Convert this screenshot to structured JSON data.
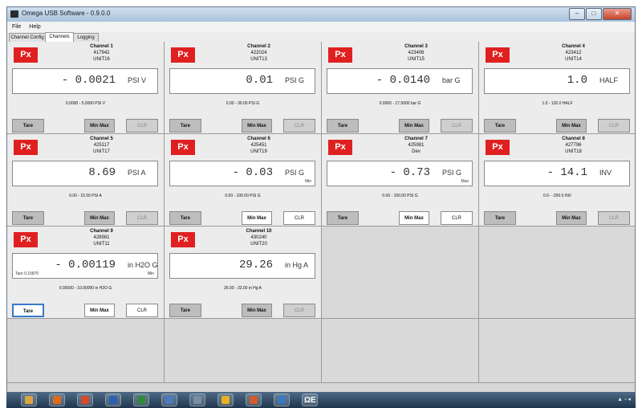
{
  "window": {
    "title": "Omega USB Software - 0.9.0.0",
    "controls": [
      "–",
      "□",
      "✕"
    ]
  },
  "menu": [
    "File",
    "Help"
  ],
  "tabs": [
    "Channel Config",
    "Channels",
    "Logging"
  ],
  "active_tab": "Channels",
  "logo_text": "Px",
  "channels": [
    {
      "title": "Channel 1",
      "serial": "417942",
      "unit_id": "UNIT16",
      "value": "- 0.0021",
      "unit": "PSI V",
      "range": "0.0000 - 5.0000 PSI V",
      "flag": "",
      "tare_note": "",
      "tare": "Tare",
      "minmax": "Min Max",
      "clr": "CLR"
    },
    {
      "title": "Channel 2",
      "serial": "422024",
      "unit_id": "UNIT13",
      "value": "0.01",
      "unit": "PSI G",
      "range": "0.00 - 30.00 PSI G",
      "flag": "",
      "tare_note": "",
      "tare": "Tare",
      "minmax": "Min Max",
      "clr": "CLR"
    },
    {
      "title": "Channel 3",
      "serial": "423406",
      "unit_id": "UNIT15",
      "value": "- 0.0140",
      "unit": "bar G",
      "range": "0.0000 - 17.5000 bar G",
      "flag": "",
      "tare_note": "",
      "tare": "Tare",
      "minmax": "Min Max",
      "clr": "CLR"
    },
    {
      "title": "Channel 4",
      "serial": "423412",
      "unit_id": "UNIT14",
      "value": "1.0",
      "unit": "HALF",
      "range": "1.0 - 126.0 HALF",
      "flag": "",
      "tare_note": "",
      "tare": "Tare",
      "minmax": "Min Max",
      "clr": "CLR"
    },
    {
      "title": "Channel 5",
      "serial": "425117",
      "unit_id": "UNIT17",
      "value": "8.69",
      "unit": "PSI A",
      "range": "0.00 - 15.00 PSI A",
      "flag": "",
      "tare_note": "",
      "tare": "Tare",
      "minmax": "Min Max",
      "clr": "CLR"
    },
    {
      "title": "Channel 6",
      "serial": "425451",
      "unit_id": "UNIT19",
      "value": "- 0.03",
      "unit": "PSI G",
      "range": "0.00 - 100.00 PSI G",
      "flag": "Min",
      "tare_note": "",
      "tare": "Tare",
      "minmax": "Min Max",
      "clr": "CLR"
    },
    {
      "title": "Channel 7",
      "serial": "425981",
      "unit_id": "Dev",
      "value": "- 0.73",
      "unit": "PSI G",
      "range": "0.00 - 100.00 PSI G",
      "flag": "Max",
      "tare_note": "",
      "tare": "Tare",
      "minmax": "Min Max",
      "clr": "CLR"
    },
    {
      "title": "Channel 8",
      "serial": "427796",
      "unit_id": "UNIT18",
      "value": "- 14.1",
      "unit": "INV",
      "range": "0.0 - -250.0 INV",
      "flag": "",
      "tare_note": "",
      "tare": "Tare",
      "minmax": "Min Max",
      "clr": "CLR"
    },
    {
      "title": "Channel 9",
      "serial": "428981",
      "unit_id": "UNIT11",
      "value": "- 0.00119",
      "unit": "in H2O G",
      "range": "0.00000 - 10.00000 in H2O G",
      "flag": "Min",
      "tare_note": "Tare 0.15870",
      "tare": "Tare",
      "minmax": "Min Max",
      "clr": "CLR"
    },
    {
      "title": "Channel 10",
      "serial": "430240",
      "unit_id": "UNIT20",
      "value": "29.26",
      "unit": "in Hg A",
      "range": "26.00 - 32.00 in Hg A",
      "flag": "",
      "tare_note": "",
      "tare": "Tare",
      "minmax": "Min Max",
      "clr": "CLR"
    }
  ],
  "taskbar": {
    "icons": [
      "folder-icon",
      "media-player-icon",
      "chrome-icon",
      "word-icon",
      "excel-icon",
      "network-icon",
      "disk-icon",
      "paint-icon",
      "powerpoint-icon",
      "monitor-icon",
      "omega-icon"
    ],
    "omega_label": "ΩE"
  },
  "colors": {
    "logo_red": "#e02020",
    "panel_bg": "#ececec",
    "active_btn": "#ffffff"
  }
}
